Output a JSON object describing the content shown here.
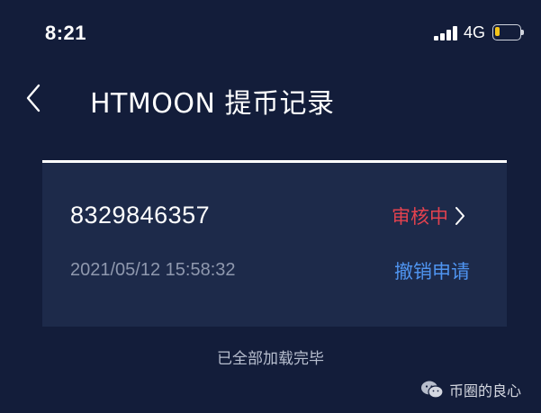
{
  "status_bar": {
    "time": "8:21",
    "network": "4G",
    "battery_level": 0.2,
    "battery_color": "#f5c518"
  },
  "nav": {
    "back_icon": "chevron-left-icon",
    "title": "HTMOON 提币记录"
  },
  "records": [
    {
      "id": "8329846357",
      "status": "审核中",
      "status_color": "#e3424f",
      "datetime": "2021/05/12 15:58:32",
      "action_label": "撤销申请",
      "action_color": "#4f94f0"
    }
  ],
  "footer": {
    "note": "已全部加载完毕"
  },
  "watermark": {
    "icon": "wechat-icon",
    "text": "币圈的良心"
  }
}
